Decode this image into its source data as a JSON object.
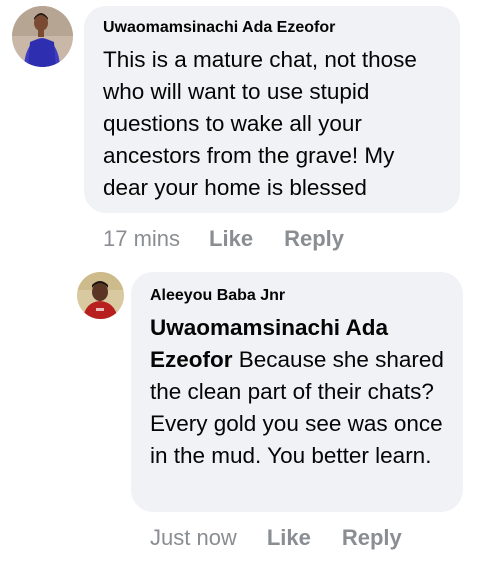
{
  "comments": [
    {
      "author": "Uwaomamsinachi Ada Ezeofor",
      "avatar_icon": "user-avatar-photo-blue-outfit",
      "text": "This is a mature chat, not those who will want to use stupid questions to wake all your ancestors from the grave! My dear your home is blessed",
      "time": "17 mins",
      "like_label": "Like",
      "reply_label": "Reply"
    },
    {
      "author": "Aleeyou Baba Jnr",
      "avatar_icon": "user-avatar-photo-red-shirt",
      "mention": "Uwaomamsinachi Ada Ezeofor",
      "text": " Because she shared the clean part of their chats?  Every gold you see was once in the mud. You better learn.",
      "time": "Just now",
      "like_label": "Like",
      "reply_label": "Reply"
    }
  ],
  "colors": {
    "bubble_bg": "#f0f2f5",
    "meta_text": "#8a8d91",
    "primary_text": "#050505"
  }
}
